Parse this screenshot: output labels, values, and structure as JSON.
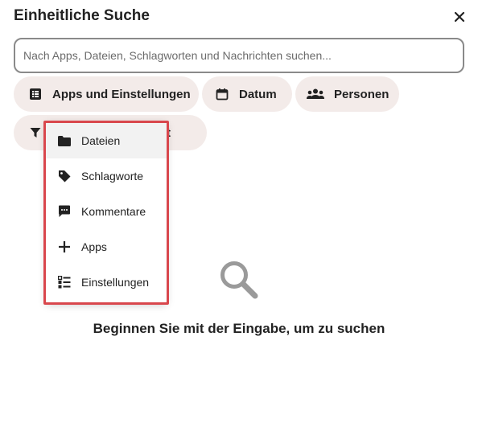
{
  "dialog": {
    "title": "Einheitliche Suche",
    "close_icon": "close-icon"
  },
  "search": {
    "value": "",
    "placeholder": "Nach Apps, Dateien, Schlagworten und Nachrichten suchen..."
  },
  "filters": {
    "apps": {
      "label": "Apps und Einstellungen",
      "icon": "list-icon"
    },
    "date": {
      "label": "Datum",
      "icon": "calendar-icon"
    },
    "people": {
      "label": "Personen",
      "icon": "people-icon"
    },
    "filter": {
      "label_visible": "sicht",
      "icon": "filter-icon"
    }
  },
  "dropdown": {
    "items": [
      {
        "label": "Dateien",
        "icon": "folder-icon",
        "active": true
      },
      {
        "label": "Schlagworte",
        "icon": "tag-icon"
      },
      {
        "label": "Kommentare",
        "icon": "comment-icon"
      },
      {
        "label": "Apps",
        "icon": "plus-icon"
      },
      {
        "label": "Einstellungen",
        "icon": "settings-list-icon"
      }
    ]
  },
  "empty_state": {
    "icon": "magnifier-icon",
    "message": "Beginnen Sie mit der Eingabe, um zu suchen"
  },
  "colors": {
    "chip_bg": "#f3ebe9",
    "highlight_outline": "#d9474d",
    "empty_icon": "#9a9a9a"
  }
}
